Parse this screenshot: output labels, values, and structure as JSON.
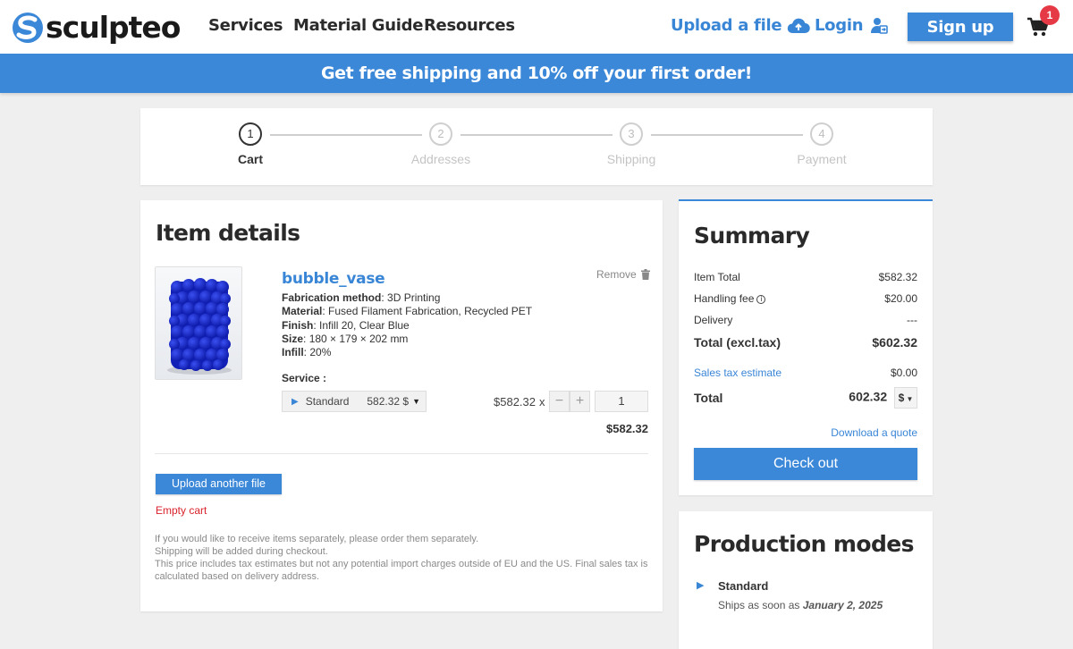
{
  "header": {
    "logo_text": "sculpteo",
    "nav": [
      "Services",
      "Material Guide",
      "Resources"
    ],
    "upload_label": "Upload a file",
    "login_label": "Login",
    "signup_label": "Sign up",
    "cart_count": "1",
    "brand_color": "#3b87d8"
  },
  "promo": {
    "text": "Get free shipping and 10% off your first order!"
  },
  "stepper": {
    "steps": [
      {
        "number": "1",
        "label": "Cart"
      },
      {
        "number": "2",
        "label": "Addresses"
      },
      {
        "number": "3",
        "label": "Shipping"
      },
      {
        "number": "4",
        "label": "Payment"
      }
    ],
    "active_step": 1
  },
  "item_details": {
    "title": "Item details",
    "item": {
      "name": "bubble_vase",
      "remove_label": "Remove",
      "properties": [
        {
          "label": "Fabrication method",
          "value": "3D Printing"
        },
        {
          "label": "Material",
          "value": "Fused Filament Fabrication, Recycled PET"
        },
        {
          "label": "Finish",
          "value": "Infill 20, Clear Blue"
        },
        {
          "label": "Size",
          "value": "180 × 179 × 202 mm"
        },
        {
          "label": "Infill",
          "value": "20%"
        }
      ],
      "service_label": "Service :",
      "service_name": "Standard",
      "service_price": "582.32 $",
      "unit_price": "$582.32",
      "times": "x",
      "minus": "−",
      "plus": "+",
      "quantity": "1",
      "line_total": "$582.32"
    },
    "upload_another_label": "Upload another file",
    "empty_cart_label": "Empty cart",
    "notes": [
      "If you would like to receive items separately, please order them separately.",
      "Shipping will be added during checkout.",
      "This price includes tax estimates but not any potential import charges outside of EU and the US. Final sales tax is calculated based on delivery address."
    ]
  },
  "summary": {
    "title": "Summary",
    "item_total_label": "Item Total",
    "item_total_value": "$582.32",
    "handling_label": "Handling fee",
    "handling_value": "$20.00",
    "delivery_label": "Delivery",
    "delivery_value": "---",
    "total_excl_label": "Total (excl.tax)",
    "total_excl_value": "$602.32",
    "sales_tax_label": "Sales tax estimate",
    "sales_tax_value": "$0.00",
    "total_label": "Total",
    "total_value": "602.32",
    "currency": "$",
    "download_quote_label": "Download a quote",
    "checkout_label": "Check out"
  },
  "production_modes": {
    "title": "Production modes",
    "mode_name": "Standard",
    "ships_prefix": "Ships as soon as",
    "ships_date": "January 2, 2025"
  }
}
